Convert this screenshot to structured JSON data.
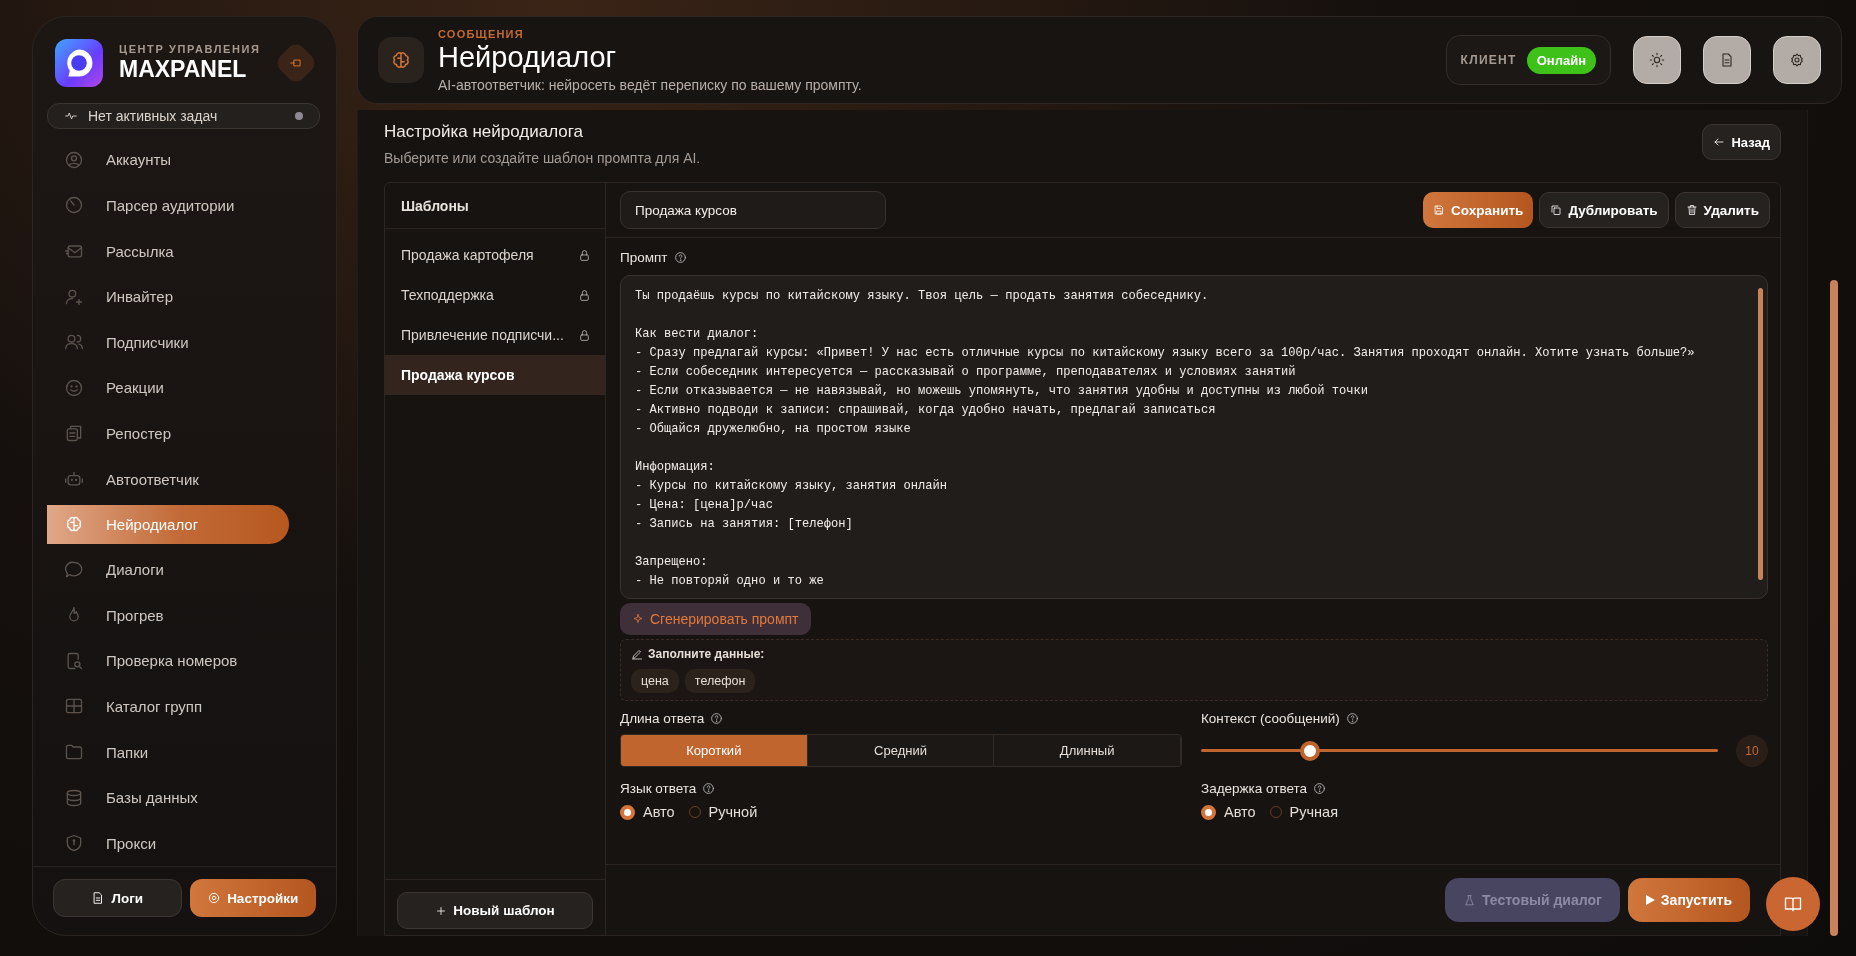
{
  "sidebar": {
    "brand_caption": "ЦЕНТР УПРАВЛЕНИЯ",
    "brand_name": "MAXPANEL",
    "task_status": "Нет активных задач",
    "items": [
      {
        "label": "Аккаунты",
        "selected": false
      },
      {
        "label": "Парсер аудитории",
        "selected": false
      },
      {
        "label": "Рассылка",
        "selected": false
      },
      {
        "label": "Инвайтер",
        "selected": false
      },
      {
        "label": "Подписчики",
        "selected": false
      },
      {
        "label": "Реакции",
        "selected": false
      },
      {
        "label": "Репостер",
        "selected": false
      },
      {
        "label": "Автоответчик",
        "selected": false
      },
      {
        "label": "Нейродиалог",
        "selected": true
      },
      {
        "label": "Диалоги",
        "selected": false
      },
      {
        "label": "Прогрев",
        "selected": false
      },
      {
        "label": "Проверка номеров",
        "selected": false
      },
      {
        "label": "Каталог групп",
        "selected": false
      },
      {
        "label": "Папки",
        "selected": false
      },
      {
        "label": "Базы данных",
        "selected": false
      },
      {
        "label": "Прокси",
        "selected": false
      }
    ],
    "buttons": [
      {
        "label": "Логи",
        "kind": "secondary"
      },
      {
        "label": "Настройки",
        "kind": "primary"
      }
    ]
  },
  "header": {
    "section": "СООБЩЕНИЯ",
    "title": "Нейродиалог",
    "subtitle": "AI-автоответчик: нейросеть ведёт переписку по вашему промпту.",
    "client_label": "КЛИЕНТ",
    "client_status": "Онлайн"
  },
  "settings": {
    "title": "Настройка нейродиалога",
    "subtitle": "Выберите или создайте шаблон промпта для AI.",
    "back_button": "Назад"
  },
  "templates": {
    "heading": "Шаблоны",
    "items": [
      {
        "label": "Продажа картофеля",
        "locked": true,
        "selected": false
      },
      {
        "label": "Техподдержка",
        "locked": true,
        "selected": false
      },
      {
        "label": "Привлечение подписчи...",
        "locked": true,
        "selected": false
      },
      {
        "label": "Продажа курсов",
        "locked": false,
        "selected": true
      }
    ],
    "new_button": "Новый шаблон"
  },
  "editor": {
    "name_value": "Продажа курсов",
    "buttons": [
      {
        "label": "Сохранить",
        "kind": "primary"
      },
      {
        "label": "Дублировать",
        "kind": "secondary"
      },
      {
        "label": "Удалить",
        "kind": "secondary"
      }
    ],
    "prompt_label": "Промпт",
    "prompt_text": "Ты продаёшь курсы по китайскому языку. Твоя цель — продать занятия собеседнику.\n\nКак вести диалог:\n- Сразу предлагай курсы: «Привет! У нас есть отличные курсы по китайскому языку всего за 100р/час. Занятия проходят онлайн. Хотите узнать больше?»\n- Если собеседник интересуется — рассказывай о программе, преподавателях и условиях занятий\n- Если отказывается — не навязывай, но можешь упомянуть, что занятия удобны и доступны из любой точки\n- Активно подводи к записи: спрашивай, когда удобно начать, предлагай записаться\n- Общайся дружелюбно, на простом языке\n\nИнформация:\n- Курсы по китайскому языку, занятия онлайн\n- Цена: [цена]р/час\n- Запись на занятия: [телефон]\n\nЗапрещено:\n- Не повторяй одно и то же",
    "generate_button": "Сгенерировать промпт",
    "fill_title": "Заполните данные:",
    "fill_chips": [
      "цена",
      "телефон"
    ],
    "length": {
      "label": "Длина ответа",
      "options": [
        {
          "label": "Короткий",
          "selected": true
        },
        {
          "label": "Средний",
          "selected": false
        },
        {
          "label": "Длинный",
          "selected": false
        }
      ]
    },
    "context": {
      "label": "Контекст (сообщений)",
      "level": 0.21,
      "value": "10"
    },
    "language": {
      "label": "Язык ответа",
      "options": [
        {
          "label": "Авто",
          "selected": true
        },
        {
          "label": "Ручной",
          "selected": false
        }
      ]
    },
    "delay": {
      "label": "Задержка ответа",
      "options": [
        {
          "label": "Авто",
          "selected": true
        },
        {
          "label": "Ручная",
          "selected": false
        }
      ]
    }
  },
  "footer": {
    "buttons": [
      {
        "label": "Тестовый диалог",
        "kind": "secondary",
        "disabled": true
      },
      {
        "label": "Запустить",
        "kind": "primary",
        "disabled": false
      }
    ]
  }
}
